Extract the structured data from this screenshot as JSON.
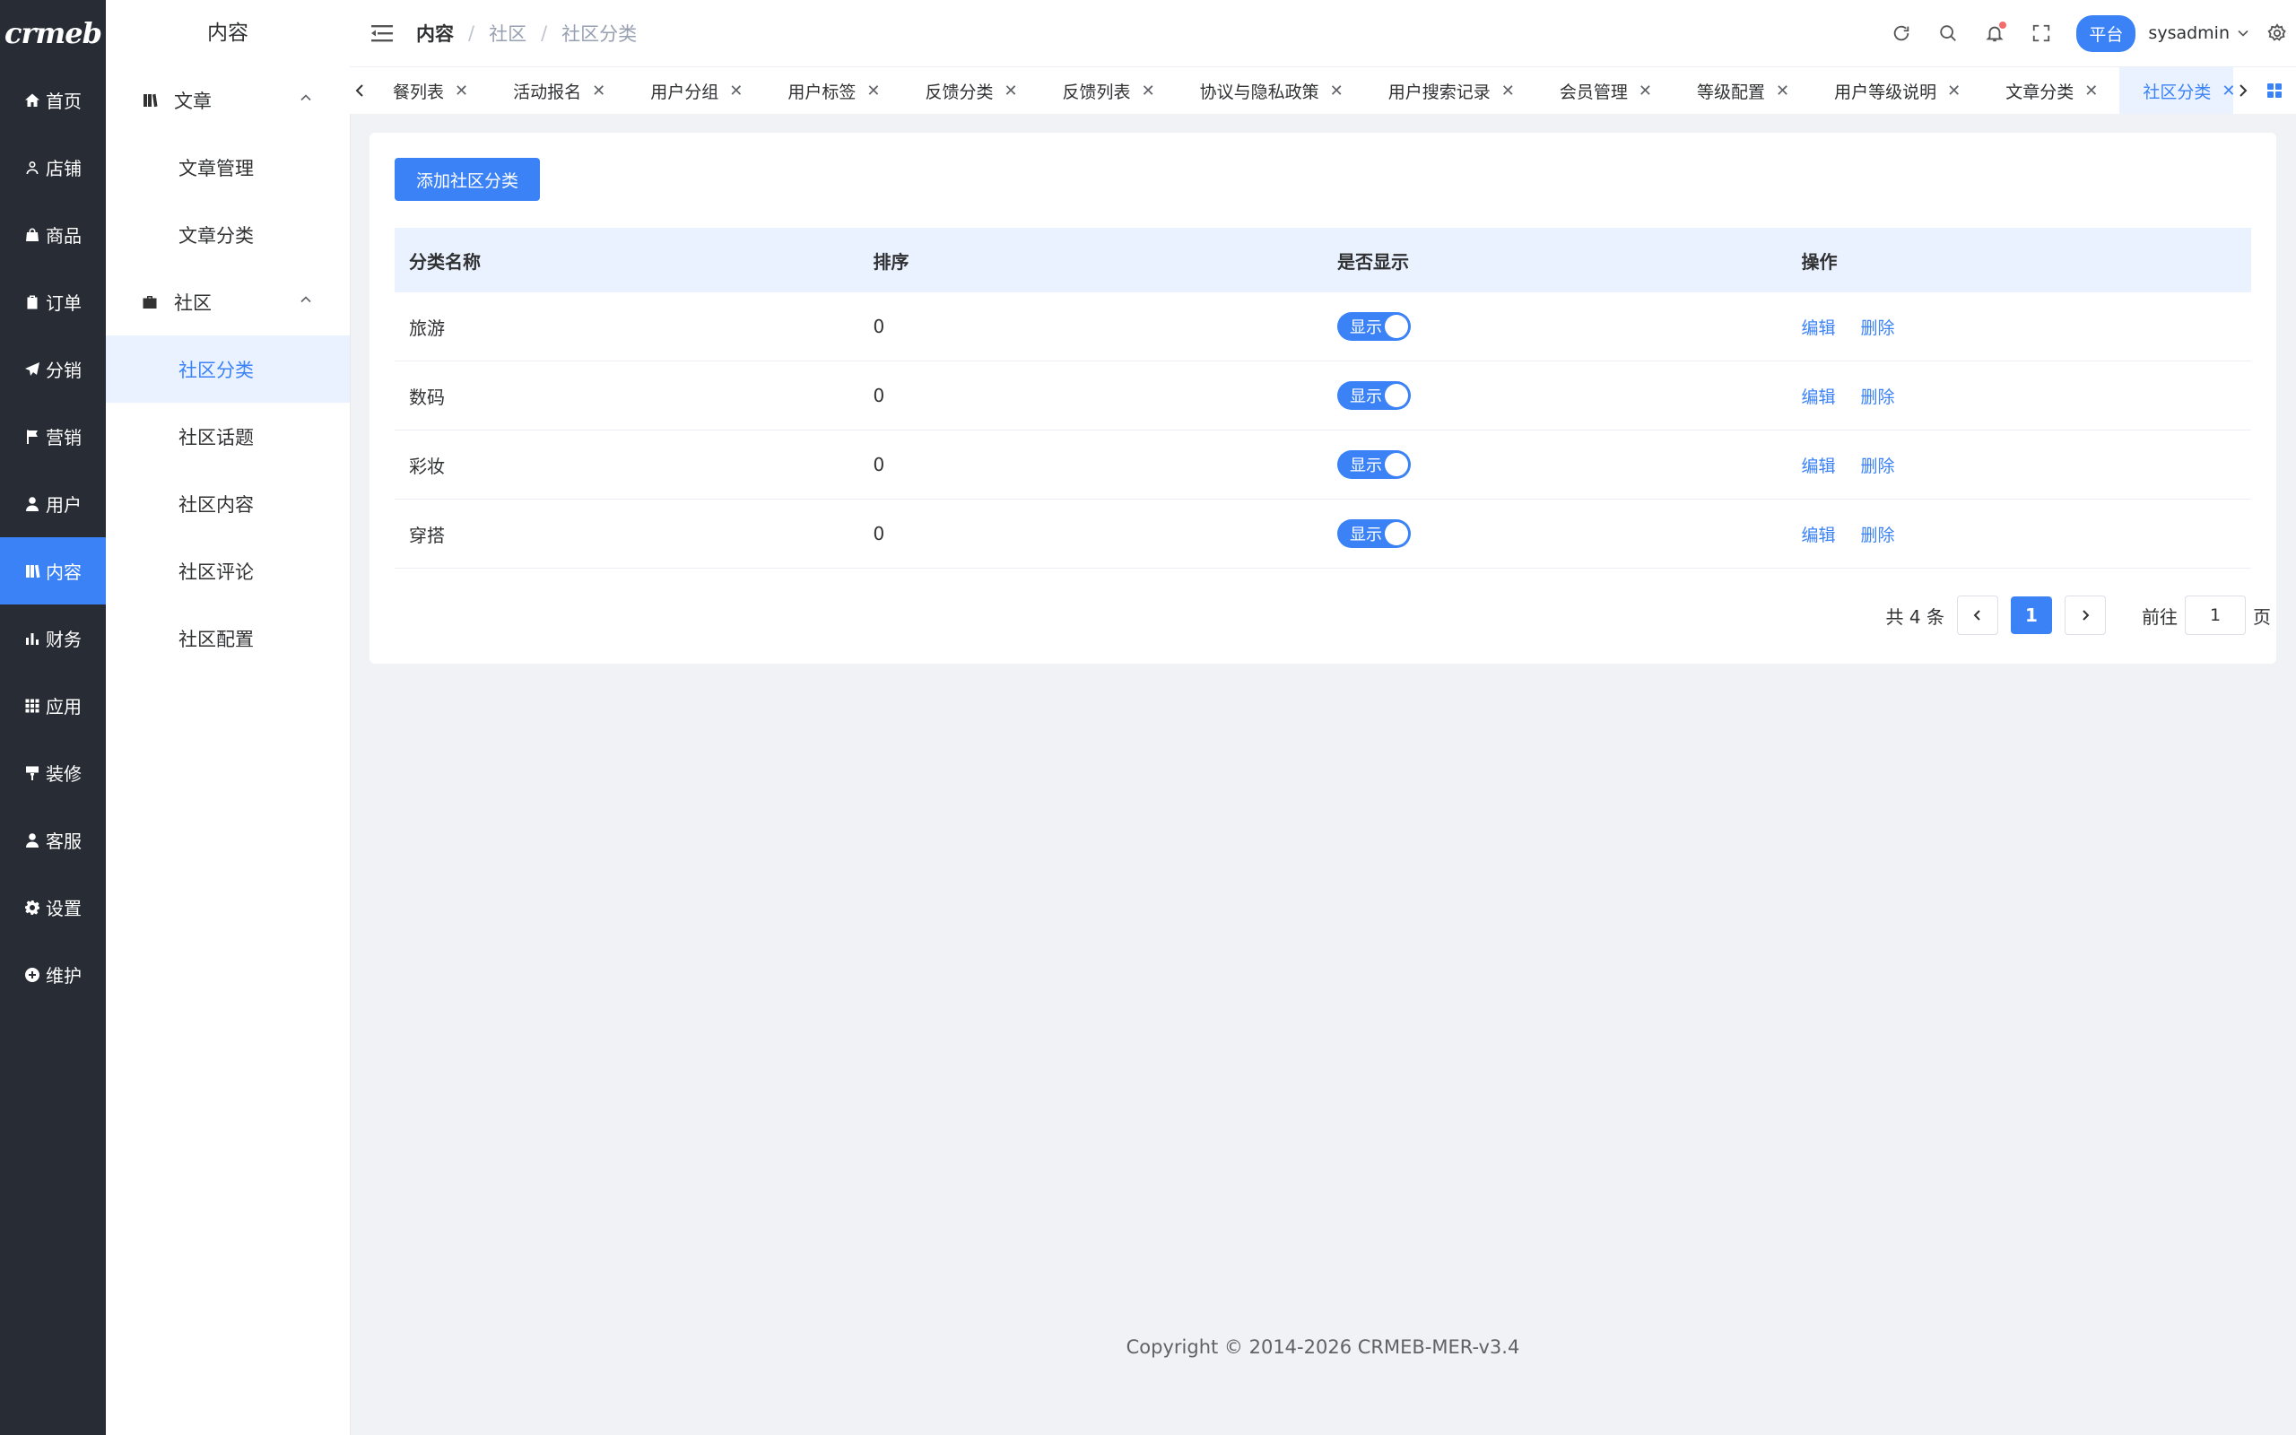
{
  "logo": "crmeb",
  "colors": {
    "primary": "#3b82f6",
    "rail_bg": "#282c34",
    "page_bg": "#f0f2f5"
  },
  "rail": [
    {
      "label": "首页",
      "icon": "home-icon",
      "active": false
    },
    {
      "label": "店铺",
      "icon": "user-outline-icon",
      "active": false
    },
    {
      "label": "商品",
      "icon": "bag-icon",
      "active": false
    },
    {
      "label": "订单",
      "icon": "clipboard-icon",
      "active": false
    },
    {
      "label": "分销",
      "icon": "paper-plane-icon",
      "active": false
    },
    {
      "label": "营销",
      "icon": "flag-icon",
      "active": false
    },
    {
      "label": "用户",
      "icon": "user-icon",
      "active": false
    },
    {
      "label": "内容",
      "icon": "book-icon",
      "active": true
    },
    {
      "label": "财务",
      "icon": "bar-chart-icon",
      "active": false
    },
    {
      "label": "应用",
      "icon": "grid-icon",
      "active": false
    },
    {
      "label": "装修",
      "icon": "brush-icon",
      "active": false
    },
    {
      "label": "客服",
      "icon": "user-icon",
      "active": false
    },
    {
      "label": "设置",
      "icon": "gear-icon",
      "active": false
    },
    {
      "label": "维护",
      "icon": "plus-circle-icon",
      "active": false
    }
  ],
  "sidebar": {
    "title": "内容",
    "groups": [
      {
        "label": "文章",
        "icon": "book-icon",
        "items": [
          "文章管理",
          "文章分类"
        ]
      },
      {
        "label": "社区",
        "icon": "briefcase-icon",
        "items": [
          "社区分类",
          "社区话题",
          "社区内容",
          "社区评论",
          "社区配置"
        ]
      }
    ],
    "active_item": "社区分类"
  },
  "header": {
    "breadcrumb": [
      "内容",
      "社区",
      "社区分类"
    ],
    "platform_label": "平台",
    "username": "sysadmin",
    "icons": [
      "refresh-icon",
      "search-icon",
      "bell-icon",
      "fullscreen-icon"
    ]
  },
  "tabs": [
    {
      "label": "餐列表",
      "active": false
    },
    {
      "label": "活动报名",
      "active": false
    },
    {
      "label": "用户分组",
      "active": false
    },
    {
      "label": "用户标签",
      "active": false
    },
    {
      "label": "反馈分类",
      "active": false
    },
    {
      "label": "反馈列表",
      "active": false
    },
    {
      "label": "协议与隐私政策",
      "active": false
    },
    {
      "label": "用户搜索记录",
      "active": false
    },
    {
      "label": "会员管理",
      "active": false
    },
    {
      "label": "等级配置",
      "active": false
    },
    {
      "label": "用户等级说明",
      "active": false
    },
    {
      "label": "文章分类",
      "active": false
    },
    {
      "label": "社区分类",
      "active": true
    }
  ],
  "main": {
    "add_button": "添加社区分类",
    "columns": [
      "分类名称",
      "排序",
      "是否显示",
      "操作"
    ],
    "rows": [
      {
        "name": "旅游",
        "sort": "0",
        "show": "显示"
      },
      {
        "name": "数码",
        "sort": "0",
        "show": "显示"
      },
      {
        "name": "彩妆",
        "sort": "0",
        "show": "显示"
      },
      {
        "name": "穿搭",
        "sort": "0",
        "show": "显示"
      }
    ],
    "row_actions": {
      "edit": "编辑",
      "delete": "删除"
    },
    "pagination": {
      "total": "共 4 条",
      "current": "1",
      "goto_label": "前往",
      "goto_value": "1",
      "page_suffix": "页"
    }
  },
  "footer": "Copyright © 2014-2026 CRMEB-MER-v3.4"
}
